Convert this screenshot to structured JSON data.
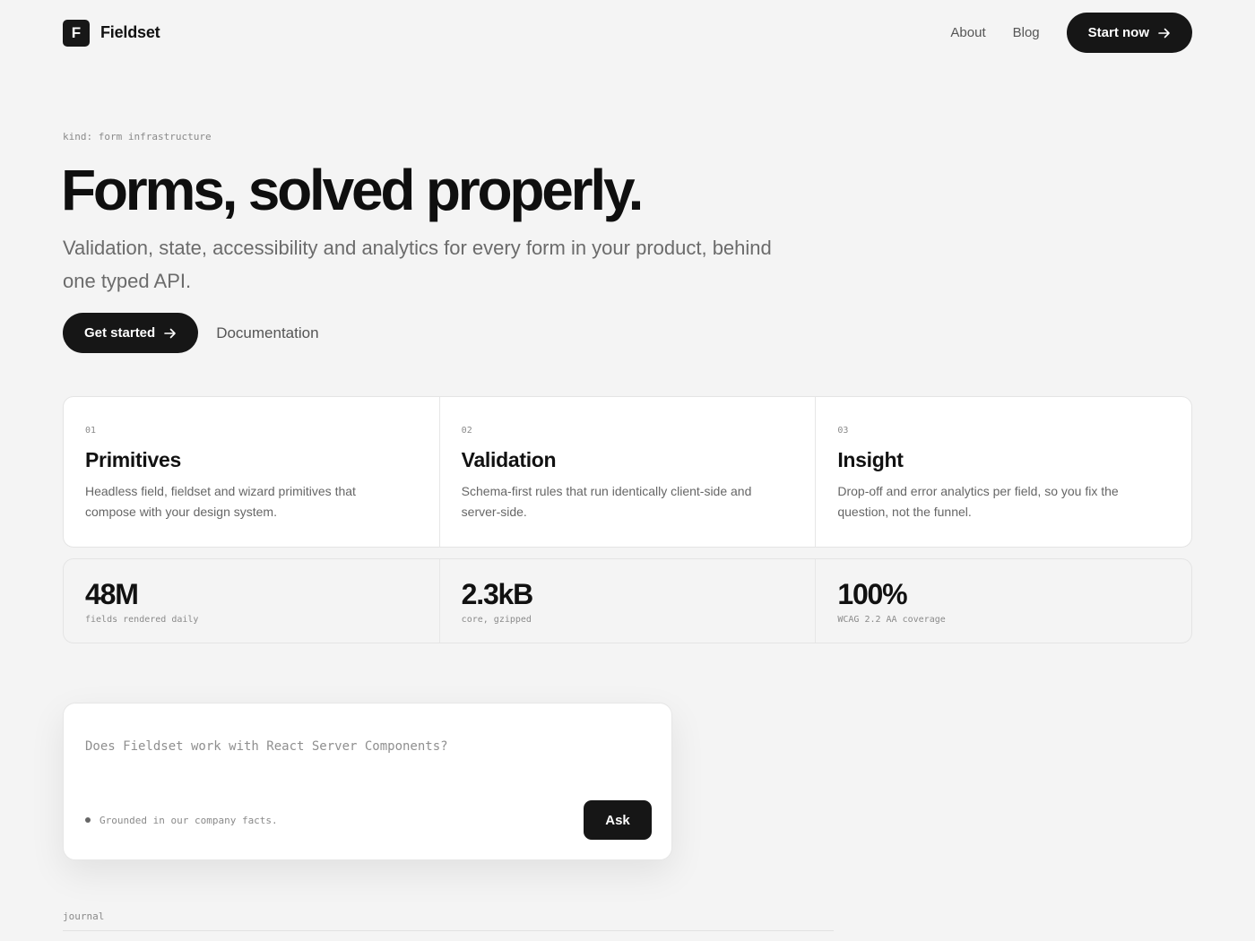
{
  "brand": {
    "logo_letter": "F",
    "name": "Fieldset"
  },
  "nav": {
    "about": "About",
    "blog": "Blog",
    "start_button": "Start now"
  },
  "hero": {
    "kind": "kind: form infrastructure",
    "title": "Forms, solved properly.",
    "subtitle": "Validation, state, accessibility and analytics for every form in your product, behind one typed API.",
    "cta_primary": "Get started",
    "cta_secondary": "Documentation"
  },
  "features": [
    {
      "num": "01",
      "title": "Primitives",
      "desc": "Headless field, fieldset and wizard primitives that compose with your design system."
    },
    {
      "num": "02",
      "title": "Validation",
      "desc": "Schema-first rules that run identically client-side and server-side."
    },
    {
      "num": "03",
      "title": "Insight",
      "desc": "Drop-off and error analytics per field, so you fix the question, not the funnel."
    }
  ],
  "stats": [
    {
      "value": "48M",
      "label": "fields rendered daily"
    },
    {
      "value": "2.3kB",
      "label": "core, gzipped"
    },
    {
      "value": "100%",
      "label": "WCAG 2.2 AA coverage"
    }
  ],
  "ask": {
    "placeholder": "Does Fieldset work with React Server Components?",
    "note": "Grounded in our company facts.",
    "button": "Ask"
  },
  "journal": {
    "label": "journal"
  },
  "icons": {
    "arrow": "arrow-right-icon",
    "status_dot": "dot-icon"
  },
  "colors": {
    "background": "#f4f4f4",
    "primary": "#161616",
    "card": "#ffffff",
    "muted_text": "#6b6b6b"
  }
}
